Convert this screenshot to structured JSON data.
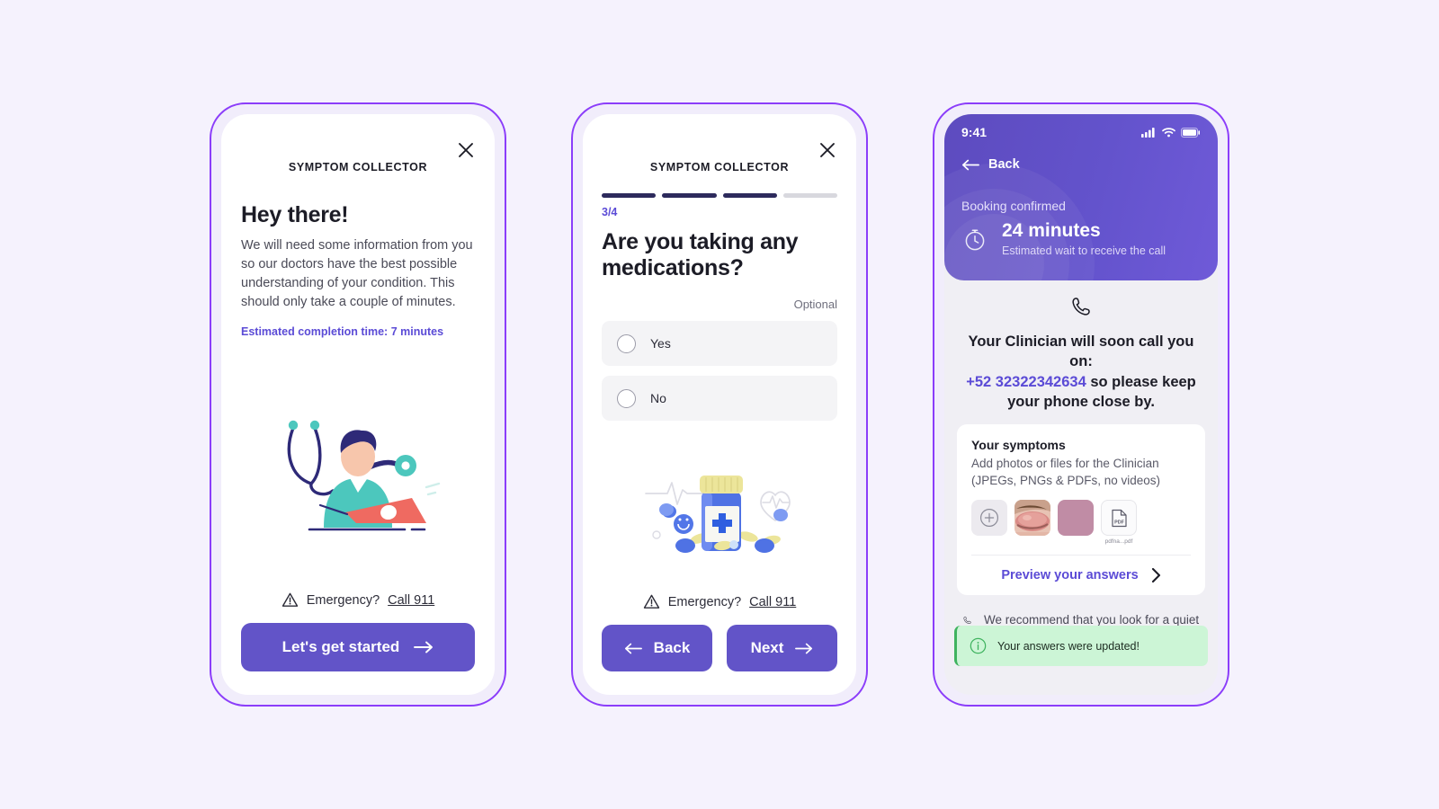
{
  "background_color": "#f5f2fd",
  "accent": {
    "purple": "#6254c8",
    "link_purple": "#5b4bd6",
    "frame": "#8b3dfa",
    "navy": "#2d2a5c",
    "toast_green_bg": "#ccf5d6",
    "toast_green_border": "#3fb35f"
  },
  "screen1": {
    "app_title": "SYMPTOM COLLECTOR",
    "close_label": "close-icon",
    "heading": "Hey there!",
    "paragraph": "We will need some information from you so our doctors have the best possible understanding of your condition. This should only take a couple of minutes.",
    "estimate": "Estimated completion time: 7 minutes",
    "emergency_prefix": "Emergency?",
    "emergency_link": "Call 911",
    "cta": "Let's get started"
  },
  "screen2": {
    "app_title": "SYMPTOM COLLECTOR",
    "progress": {
      "current": 3,
      "total": 4,
      "label": "3/4",
      "segments": [
        true,
        true,
        true,
        false
      ]
    },
    "question": "Are you taking any medications?",
    "optional_label": "Optional",
    "options": [
      {
        "label": "Yes",
        "selected": false
      },
      {
        "label": "No",
        "selected": false
      }
    ],
    "emergency_prefix": "Emergency?",
    "emergency_link": "Call 911",
    "back": "Back",
    "next": "Next"
  },
  "screen3": {
    "statusbar": {
      "time": "9:41",
      "signal": "signal-icon",
      "wifi": "wifi-icon",
      "battery": "battery-icon"
    },
    "back": "Back",
    "booking_status": "Booking confirmed",
    "wait_time": "24 minutes",
    "wait_sub": "Estimated wait to receive the call",
    "call_line1": "Your Clinician will soon call you on:",
    "phone_number": "+52 32322342634",
    "call_line2": "so please keep your phone close by.",
    "symptoms_title": "Your symptoms",
    "symptoms_sub": "Add photos or files for the Clinician (JPEGs, PNGs & PDFs, no videos)",
    "attachments": [
      {
        "type": "add",
        "label": "+"
      },
      {
        "type": "photo",
        "label": "eyelid-photo"
      },
      {
        "type": "photo",
        "label": "pink-swatch-photo"
      },
      {
        "type": "file",
        "label": "PDF",
        "filename": "pdfna...pdf"
      }
    ],
    "preview_label": "Preview your answers",
    "recommendation": "We recommend that you look for a quiet space to have your consultation.",
    "toast": "Your answers were updated!"
  }
}
